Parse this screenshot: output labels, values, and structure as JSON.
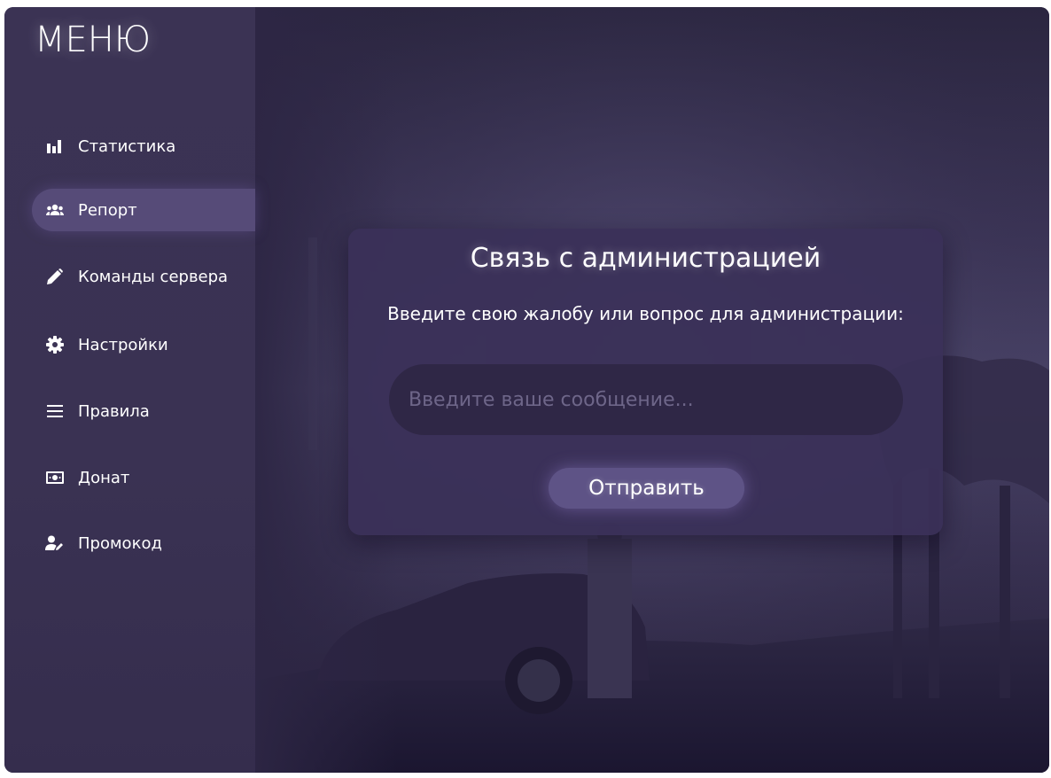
{
  "menu": {
    "title": "МЕНЮ",
    "items": [
      {
        "label": "Статистика",
        "icon": "bar-chart-icon",
        "active": false
      },
      {
        "label": "Репорт",
        "icon": "users-icon",
        "active": true
      },
      {
        "label": "Команды сервера",
        "icon": "pencil-icon",
        "active": false
      },
      {
        "label": "Настройки",
        "icon": "gear-icon",
        "active": false
      },
      {
        "label": "Правила",
        "icon": "list-icon",
        "active": false
      },
      {
        "label": "Донат",
        "icon": "money-icon",
        "active": false
      },
      {
        "label": "Промокод",
        "icon": "user-edit-icon",
        "active": false
      }
    ]
  },
  "report": {
    "title": "Связь с администрацией",
    "subtitle": "Введите свою жалобу или вопрос для администрации:",
    "input_placeholder": "Введите ваше сообщение...",
    "input_value": "",
    "send_label": "Отправить"
  },
  "colors": {
    "sidebar": "#3b3354",
    "active_item": "#564b78",
    "card": "#3a3058",
    "input": "#2f2746",
    "button": "#5e5386",
    "text": "#ffffff"
  }
}
